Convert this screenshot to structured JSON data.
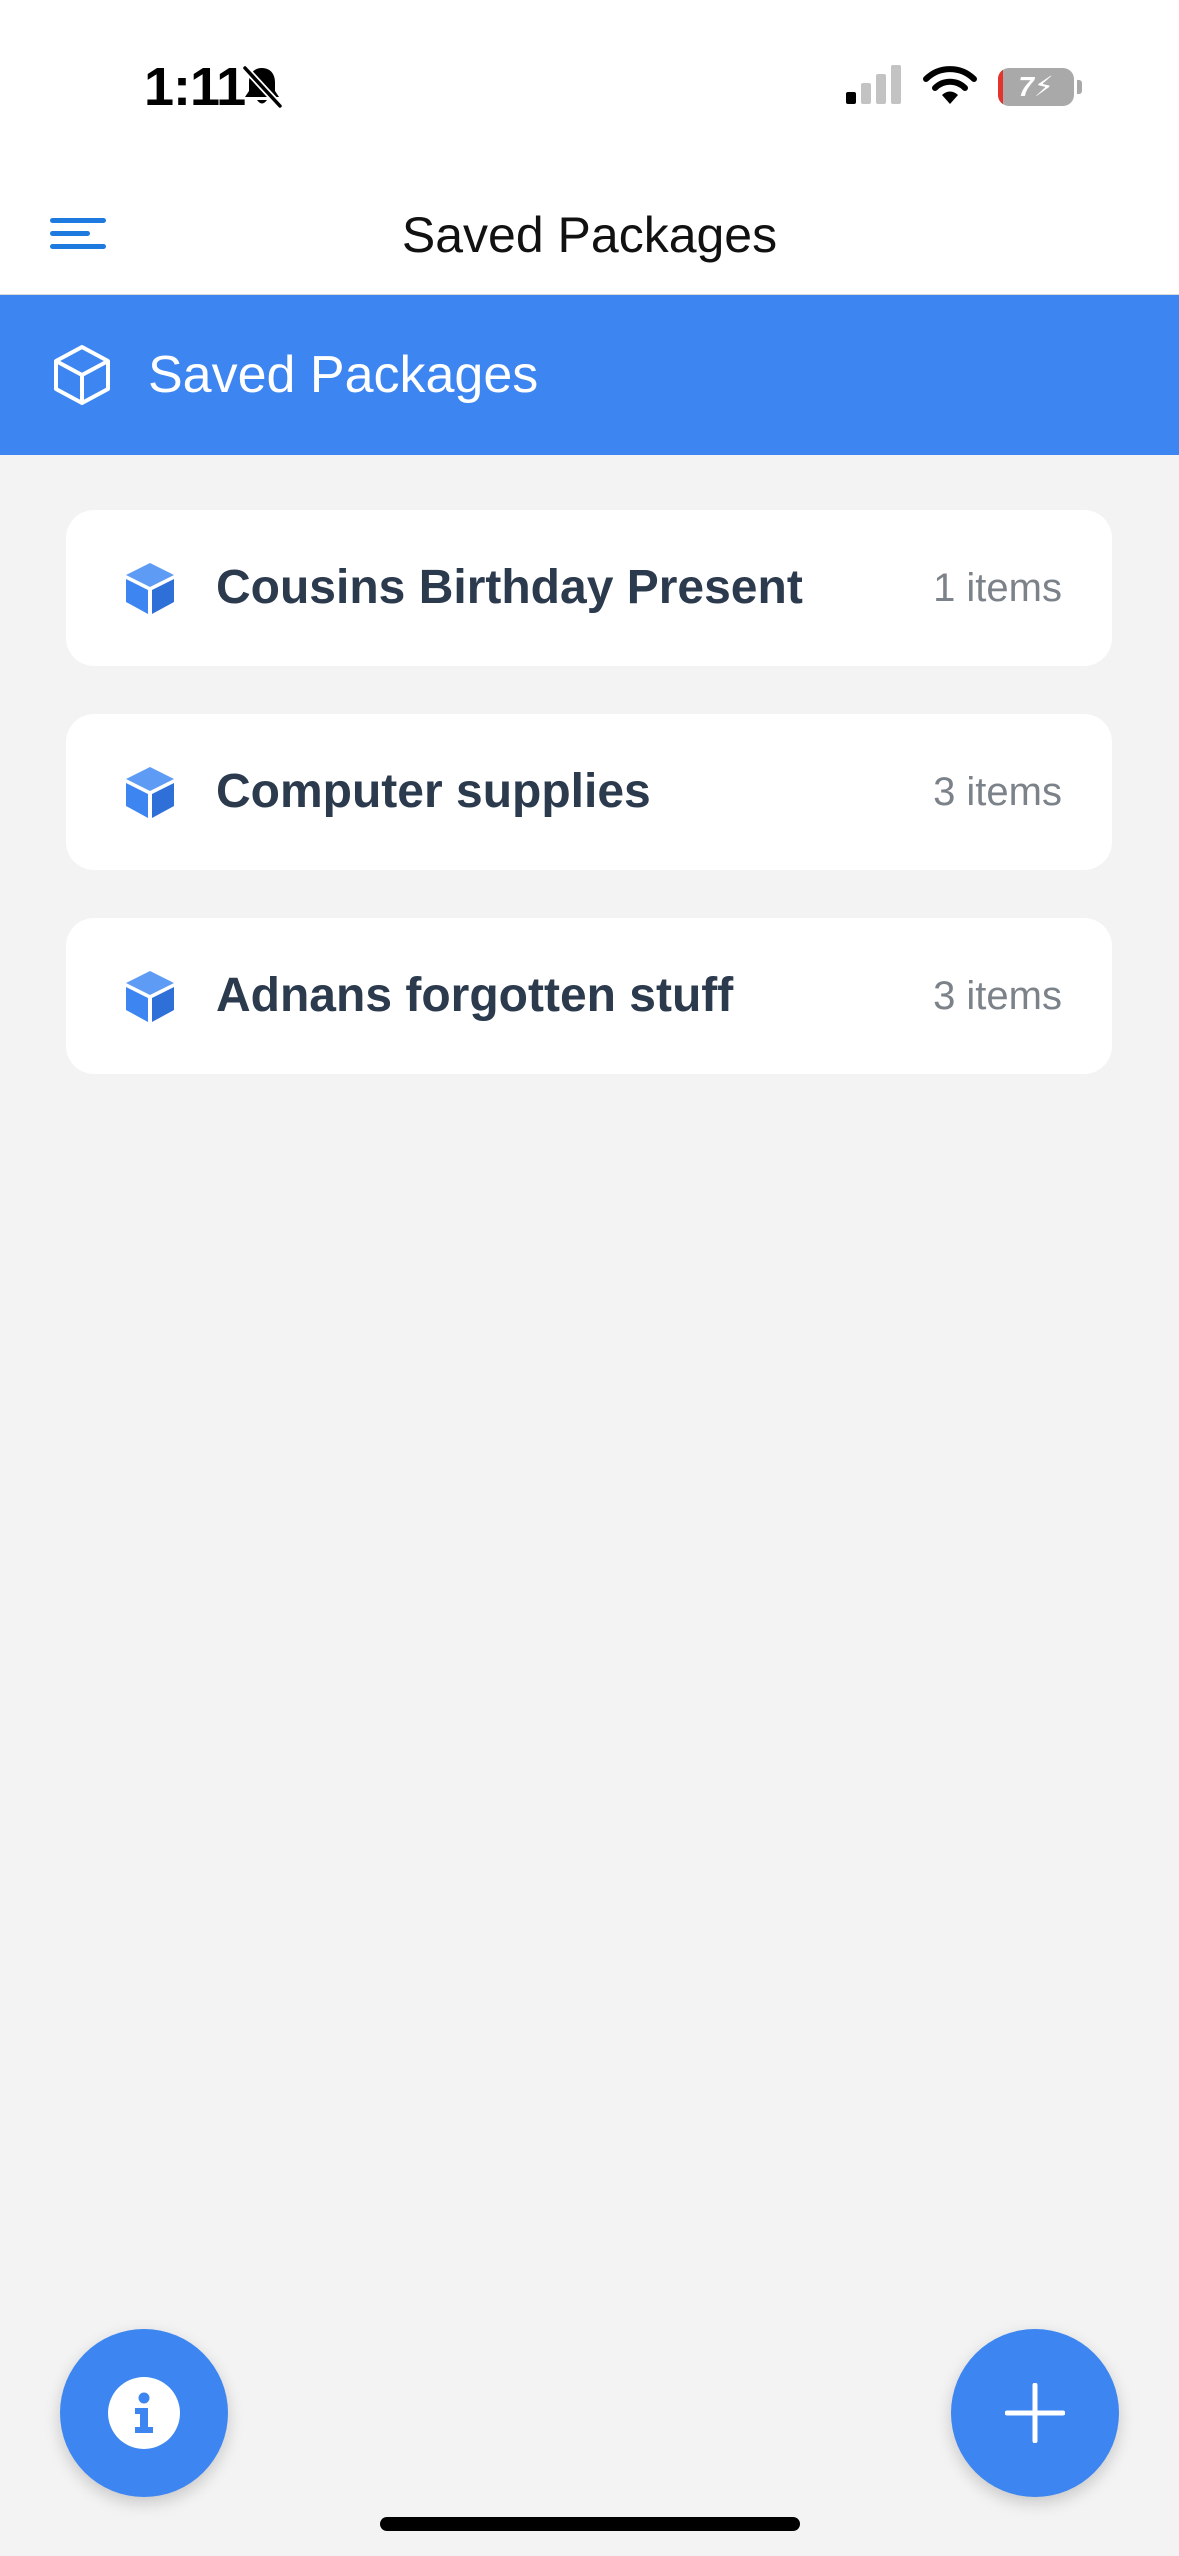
{
  "status_bar": {
    "time": "1:11",
    "battery_level": "7",
    "battery_percent": 7,
    "icons": [
      "bell-slash-icon",
      "cellular-signal-icon",
      "wifi-icon",
      "battery-charging-icon"
    ]
  },
  "nav": {
    "title": "Saved Packages",
    "menu_icon": "hamburger-menu-icon"
  },
  "header": {
    "title": "Saved Packages",
    "icon": "package-outline-icon"
  },
  "packages": [
    {
      "name": "Cousins Birthday Present",
      "count": "1 items"
    },
    {
      "name": "Computer supplies",
      "count": "3 items"
    },
    {
      "name": "Adnans forgotten stuff",
      "count": "3 items"
    }
  ],
  "fabs": {
    "info_icon": "info-icon",
    "add_icon": "plus-icon"
  },
  "colors": {
    "accent": "#3d85f0",
    "menu_icon": "#1f7ae0",
    "card_background": "#ffffff",
    "page_background": "#f3f3f3",
    "package_name_text": "#2c3a4e",
    "package_count_text": "#7c8289"
  }
}
